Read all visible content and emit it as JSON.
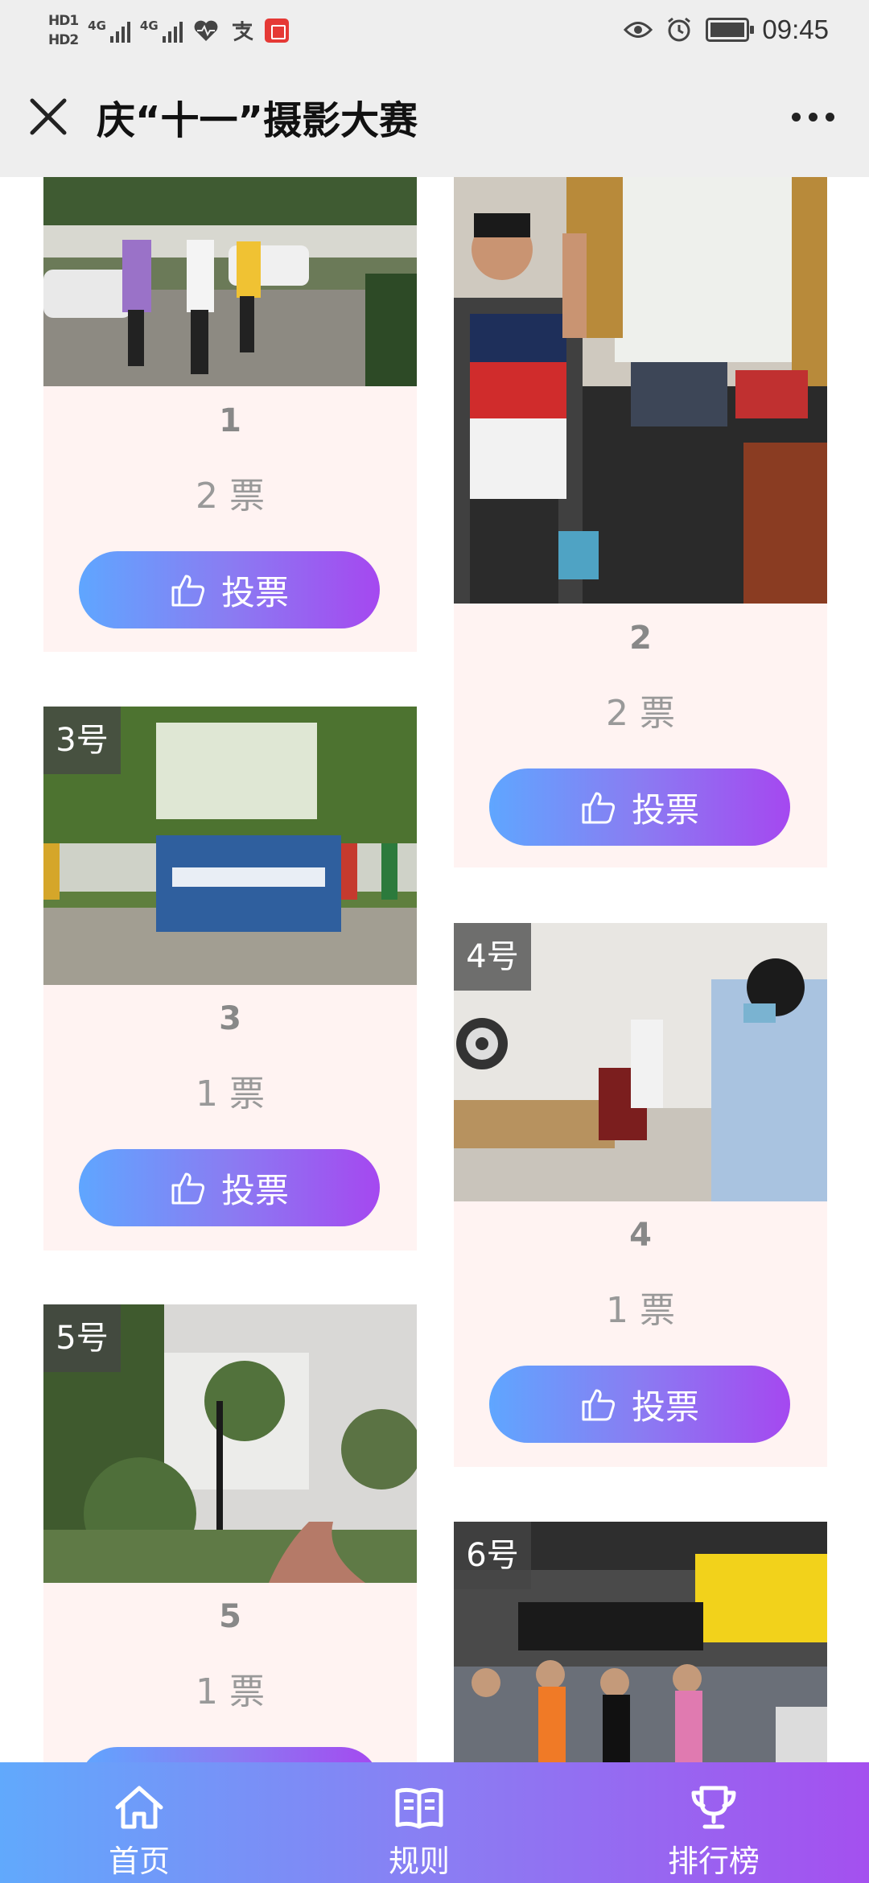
{
  "status_bar": {
    "hd1": "HD1",
    "hd2": "HD2",
    "signal1_tag": "4G",
    "signal2_tag": "4G",
    "time": "09:45",
    "icons": [
      "hd-icon",
      "signal-icon",
      "heart-rate-icon",
      "alipay-icon",
      "red-book-icon",
      "eye-icon",
      "alarm-icon",
      "battery-icon"
    ]
  },
  "header": {
    "title": "庆“十一”摄影大赛",
    "close_icon": "close-icon",
    "more_icon": "more-icon"
  },
  "entries": [
    {
      "badge": "",
      "title": "1",
      "votes": "2 票",
      "vote_label": "投票"
    },
    {
      "badge": "",
      "title": "2",
      "votes": "2 票",
      "vote_label": "投票"
    },
    {
      "badge": "3号",
      "title": "3",
      "votes": "1 票",
      "vote_label": "投票"
    },
    {
      "badge": "4号",
      "title": "4",
      "votes": "1 票",
      "vote_label": "投票"
    },
    {
      "badge": "5号",
      "title": "5",
      "votes": "1 票",
      "vote_label": "投票"
    },
    {
      "badge": "6号",
      "title": "",
      "votes": "",
      "vote_label": ""
    }
  ],
  "tabbar": {
    "items": [
      {
        "label": "首页",
        "icon": "home-icon"
      },
      {
        "label": "规则",
        "icon": "book-icon"
      },
      {
        "label": "排行榜",
        "icon": "trophy-icon"
      }
    ]
  },
  "colors": {
    "card_bg": "#fff3f2",
    "gradient_start": "#5fa6ff",
    "gradient_end": "#a548f0",
    "header_bg": "#eeeeee"
  }
}
